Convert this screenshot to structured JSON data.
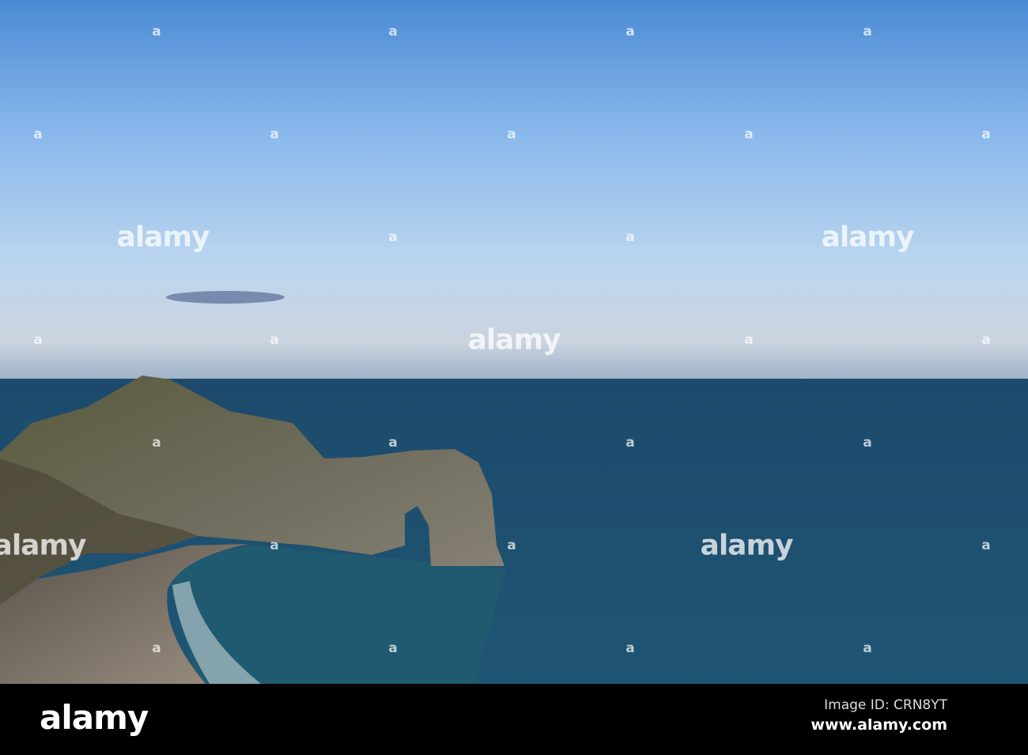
{
  "watermark": {
    "text": "alamy",
    "mark": "a"
  },
  "footer": {
    "logo": "alamy",
    "image_id": "Image ID: CRN8YT",
    "site": "www.alamy.com"
  },
  "colors": {
    "sky_top": "#4a8ad4",
    "sky_horizon": "#c9d6e4",
    "sea": "#1e4f6e",
    "rock": "#6b6a55"
  }
}
